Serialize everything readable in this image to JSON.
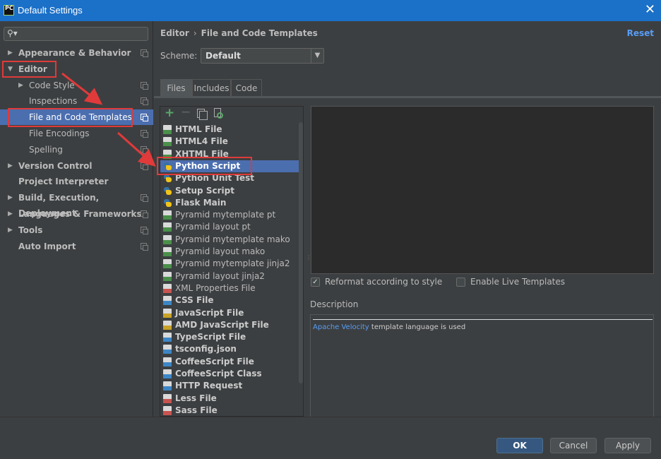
{
  "window": {
    "title": "Default Settings",
    "app_icon_text": "PC"
  },
  "sidebar": {
    "items": [
      {
        "label": "Appearance & Behavior",
        "arrow": "▶",
        "bold": true
      },
      {
        "label": "Editor",
        "arrow": "▼",
        "bold": true
      },
      {
        "label": "Code Style",
        "arrow": "▶",
        "bold": false
      },
      {
        "label": "Inspections",
        "arrow": "",
        "bold": false
      },
      {
        "label": "File and Code Templates",
        "arrow": "",
        "bold": false
      },
      {
        "label": "File Encodings",
        "arrow": "",
        "bold": false
      },
      {
        "label": "Spelling",
        "arrow": "",
        "bold": false
      },
      {
        "label": "Version Control",
        "arrow": "▶",
        "bold": true
      },
      {
        "label": "Project Interpreter",
        "arrow": "",
        "bold": true
      },
      {
        "label": "Build, Execution, Deployment",
        "arrow": "▶",
        "bold": true
      },
      {
        "label": "Languages & Frameworks",
        "arrow": "▶",
        "bold": true
      },
      {
        "label": "Tools",
        "arrow": "▶",
        "bold": true
      },
      {
        "label": "Auto Import",
        "arrow": "",
        "bold": true
      }
    ],
    "selected": "File and Code Templates"
  },
  "breadcrumb": {
    "parent": "Editor",
    "separator": "›",
    "current": "File and Code Templates"
  },
  "reset_label": "Reset",
  "scheme": {
    "label": "Scheme:",
    "value": "Default"
  },
  "tabs": [
    "Files",
    "Includes",
    "Code"
  ],
  "templates": [
    {
      "name": "HTML File",
      "bold": true,
      "badge": "H",
      "color": "#4a8f4a"
    },
    {
      "name": "HTML4 File",
      "bold": true,
      "badge": "H",
      "color": "#4a8f4a"
    },
    {
      "name": "XHTML File",
      "bold": true,
      "badge": "X",
      "color": "#4a8f4a"
    },
    {
      "name": "Python Script",
      "bold": true,
      "badge": "py",
      "color": "#3572a5"
    },
    {
      "name": "Python Unit Test",
      "bold": true,
      "badge": "py",
      "color": "#3572a5"
    },
    {
      "name": "Setup Script",
      "bold": true,
      "badge": "py",
      "color": "#3572a5"
    },
    {
      "name": "Flask Main",
      "bold": true,
      "badge": "py",
      "color": "#3572a5"
    },
    {
      "name": "Pyramid mytemplate pt",
      "bold": false,
      "badge": "C",
      "color": "#4a8f4a"
    },
    {
      "name": "Pyramid layout pt",
      "bold": false,
      "badge": "C",
      "color": "#4a8f4a"
    },
    {
      "name": "Pyramid mytemplate mako",
      "bold": false,
      "badge": "M",
      "color": "#4a8f4a"
    },
    {
      "name": "Pyramid layout mako",
      "bold": false,
      "badge": "M",
      "color": "#4a8f4a"
    },
    {
      "name": "Pyramid mytemplate jinja2",
      "bold": false,
      "badge": "J",
      "color": "#4a8f4a"
    },
    {
      "name": "Pyramid layout jinja2",
      "bold": false,
      "badge": "J",
      "color": "#4a8f4a"
    },
    {
      "name": "XML Properties File",
      "bold": false,
      "badge": "X",
      "color": "#c75450"
    },
    {
      "name": "CSS File",
      "bold": true,
      "badge": "C",
      "color": "#3d86c6"
    },
    {
      "name": "JavaScript File",
      "bold": true,
      "badge": "JS",
      "color": "#c9a227"
    },
    {
      "name": "AMD JavaScript File",
      "bold": true,
      "badge": "JS",
      "color": "#c9a227"
    },
    {
      "name": "TypeScript File",
      "bold": true,
      "badge": "TS",
      "color": "#3d86c6"
    },
    {
      "name": "tsconfig.json",
      "bold": true,
      "badge": "{}",
      "color": "#3d86c6"
    },
    {
      "name": "CoffeeScript File",
      "bold": true,
      "badge": "C",
      "color": "#3d86c6"
    },
    {
      "name": "CoffeeScript Class",
      "bold": true,
      "badge": "C",
      "color": "#3d86c6"
    },
    {
      "name": "HTTP Request",
      "bold": true,
      "badge": "API",
      "color": "#3d86c6"
    },
    {
      "name": "Less File",
      "bold": true,
      "badge": "L",
      "color": "#c75450"
    },
    {
      "name": "Sass File",
      "bold": true,
      "badge": "S",
      "color": "#c75450"
    }
  ],
  "selected_template": "Python Script",
  "options": {
    "reformat": {
      "label": "Reformat according to style",
      "checked": true
    },
    "live_templates": {
      "label": "Enable Live Templates",
      "checked": false
    }
  },
  "description": {
    "label": "Description",
    "link_text": "Apache Velocity",
    "rest_text": " template language is used"
  },
  "buttons": {
    "ok": "OK",
    "cancel": "Cancel",
    "apply": "Apply",
    "help": "?"
  },
  "colors": {
    "accent": "#4b6eaf",
    "highlight": "#e03a3a",
    "titlebar": "#1b70c8"
  }
}
